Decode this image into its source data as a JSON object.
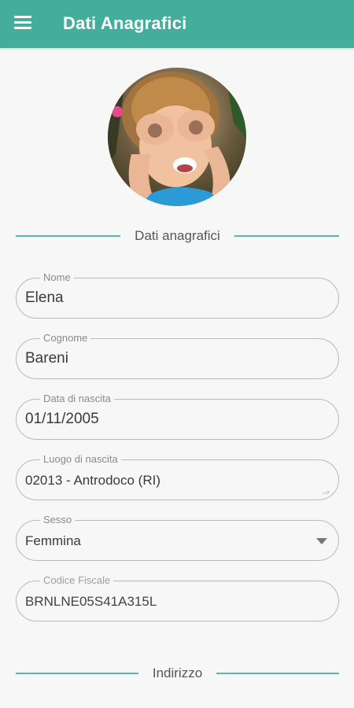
{
  "appbar": {
    "title": "Dati Anagrafici",
    "menu_icon": "hamburger-menu-icon"
  },
  "colors": {
    "primary": "#45ad9c",
    "divider": "#5fb3ad"
  },
  "sections": {
    "personal": "Dati anagrafici",
    "address": "Indirizzo"
  },
  "fields": {
    "nome": {
      "label": "Nome",
      "value": "Elena"
    },
    "cognome": {
      "label": "Cognome",
      "value": "Bareni"
    },
    "data_nascita": {
      "label": "Data di nascita",
      "value": "01/11/2005"
    },
    "luogo_nascita": {
      "label": "Luogo di nascita",
      "value": "02013 - Antrodoco (RI)"
    },
    "sesso": {
      "label": "Sesso",
      "value": "Femmina"
    },
    "codice_fiscale": {
      "label": "Codice Fiscale",
      "value": "BRNLNE05S41A315L"
    }
  }
}
